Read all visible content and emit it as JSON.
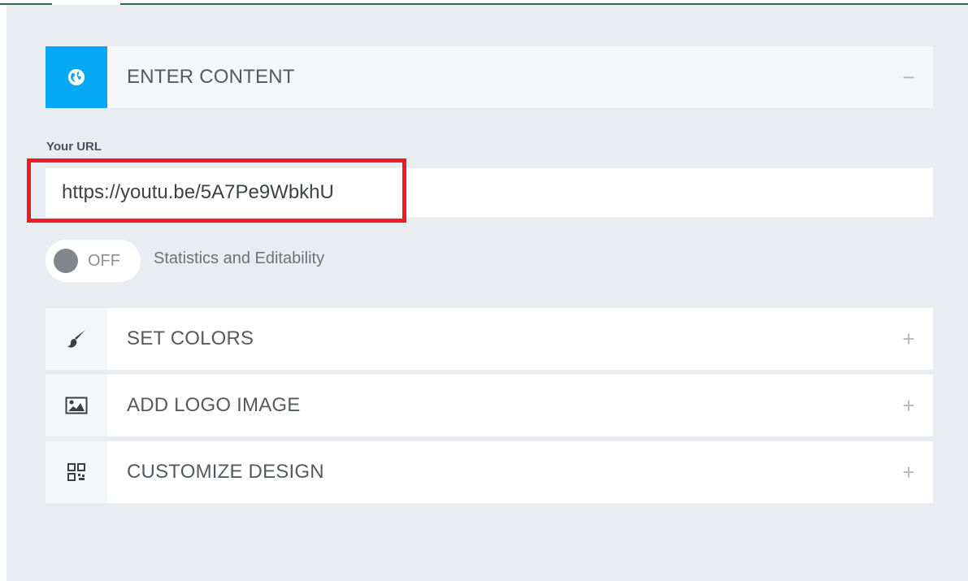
{
  "content_section": {
    "title": "ENTER CONTENT",
    "toggle_symbol": "−",
    "icon": "globe-icon",
    "accent_color": "#03a9f4"
  },
  "url_field": {
    "label": "Your URL",
    "value": "https://youtu.be/5A7Pe9WbkhU"
  },
  "stats_toggle": {
    "state_label": "OFF",
    "description": "Statistics and Editability"
  },
  "sections": [
    {
      "title": "SET COLORS",
      "icon": "brush-icon",
      "toggle_symbol": "+"
    },
    {
      "title": "ADD LOGO IMAGE",
      "icon": "image-icon",
      "toggle_symbol": "+"
    },
    {
      "title": "CUSTOMIZE DESIGN",
      "icon": "qr-code-icon",
      "toggle_symbol": "+"
    }
  ],
  "colors": {
    "highlight_border": "#ee1c25",
    "panel_background": "#e9edf1",
    "top_border": "#2e6b47"
  }
}
